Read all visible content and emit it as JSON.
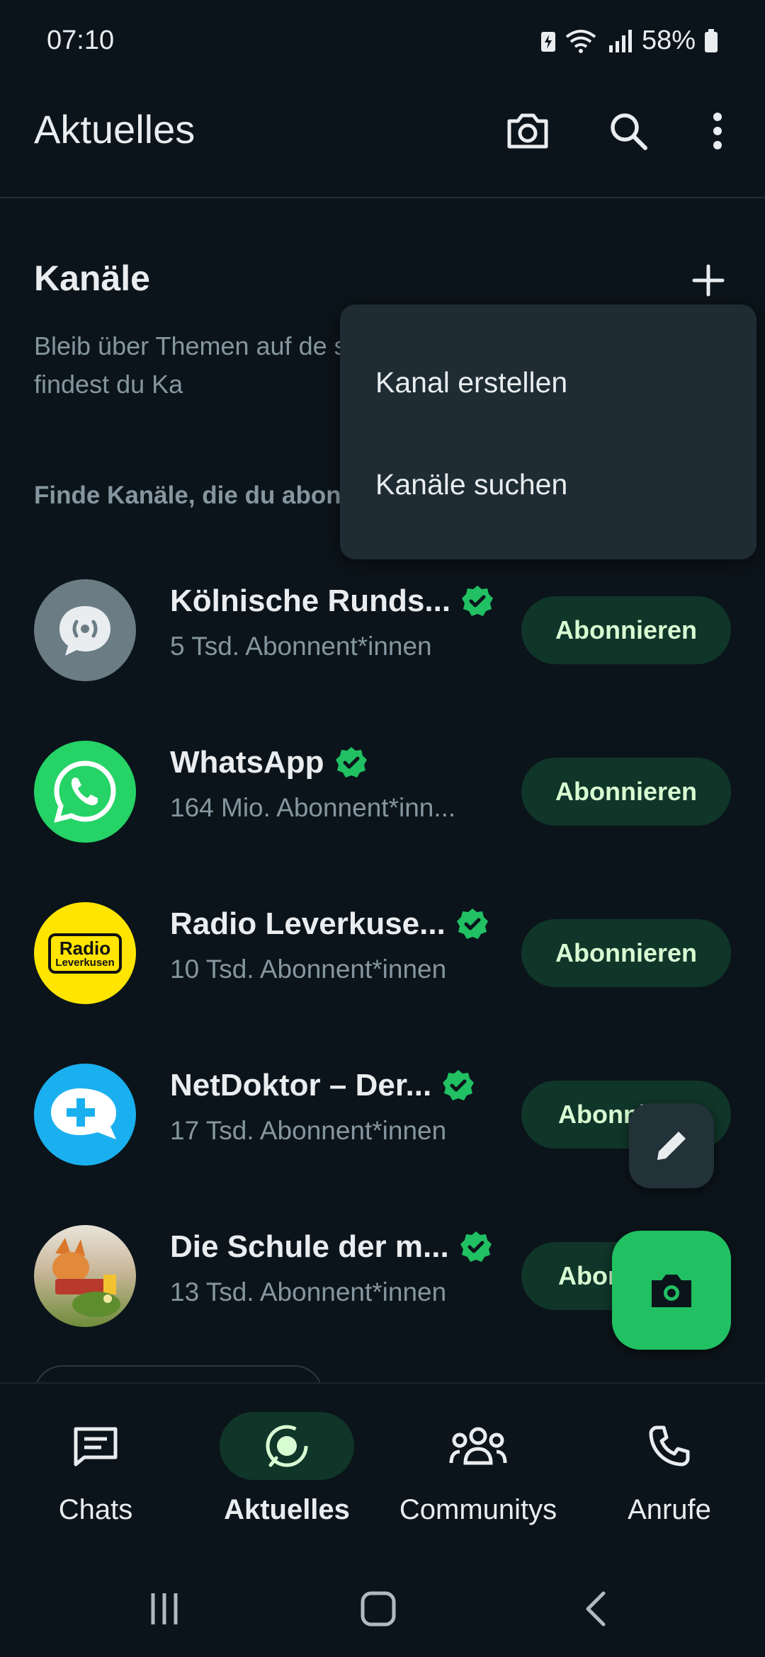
{
  "status_bar": {
    "time": "07:10",
    "battery": "58%"
  },
  "app_bar": {
    "title": "Aktuelles"
  },
  "channels": {
    "title": "Kanäle",
    "description": "Bleib über Themen auf de sind. Unten findest du Ka",
    "find_label": "Finde Kanäle, die du abonn",
    "menu": [
      "Kanal erstellen",
      "Kanäle suchen"
    ],
    "subscribe_label": "Abonnieren",
    "subscribe_label_partial_1": "Abonni",
    "subscribe_label_partial_2": "Abon",
    "items": [
      {
        "name": "Kölnische Runds...",
        "subscribers": "5 Tsd. Abonnent*innen",
        "avatar": "broadcast-icon",
        "avatar_color": "#6b7c85"
      },
      {
        "name": "WhatsApp",
        "subscribers": "164 Mio. Abonnent*inn...",
        "avatar": "whatsapp-logo",
        "avatar_color": "#25d366"
      },
      {
        "name": "Radio Leverkuse...",
        "subscribers": "10 Tsd. Abonnent*innen",
        "avatar": "radio-leverkusen-logo",
        "avatar_color": "#ffe500",
        "logo_text_1": "Radio",
        "logo_text_2": "Leverkusen"
      },
      {
        "name": "NetDoktor – Der...",
        "subscribers": "17 Tsd. Abonnent*innen",
        "avatar": "netdoktor-logo",
        "avatar_color": "#1ab0ef"
      },
      {
        "name": "Die Schule der m...",
        "subscribers": "13 Tsd. Abonnent*innen",
        "avatar": "schule-magischen-tiere-image",
        "avatar_color": "#c9b79a"
      }
    ]
  },
  "bottom_nav": [
    {
      "label": "Chats",
      "icon": "chats-icon",
      "active": false
    },
    {
      "label": "Aktuelles",
      "icon": "updates-icon",
      "active": true
    },
    {
      "label": "Communitys",
      "icon": "communities-icon",
      "active": false
    },
    {
      "label": "Anrufe",
      "icon": "calls-icon",
      "active": false
    }
  ],
  "colors": {
    "background": "#0b141a",
    "accent": "#21c063",
    "pill": "#103529",
    "muted": "#8696a0"
  }
}
